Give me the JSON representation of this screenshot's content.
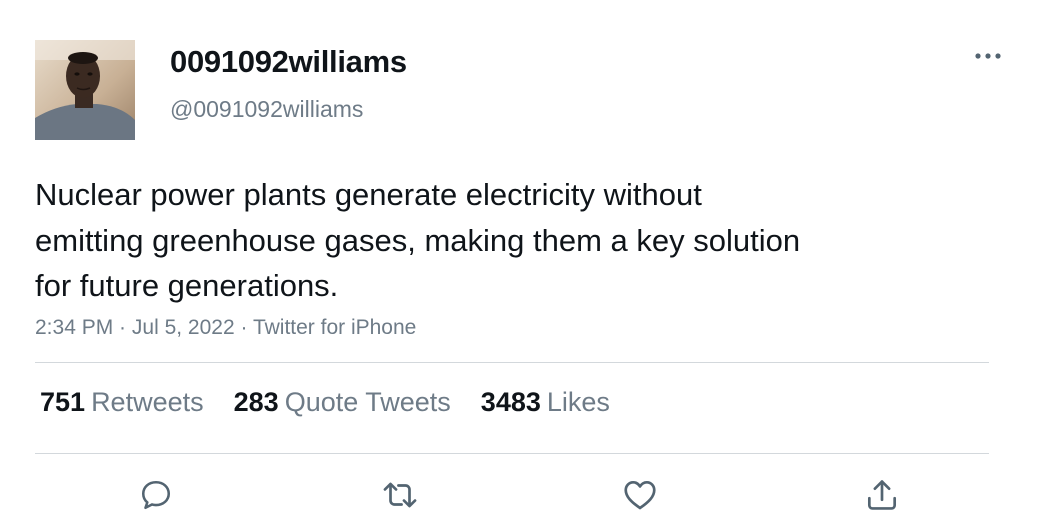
{
  "author": {
    "display_name": "0091092williams",
    "handle": "@0091092williams",
    "avatar": "profile-photo"
  },
  "more_icon": "more-horizontal-icon",
  "tweet": {
    "text_lines": [
      "Nuclear power plants generate electricity without",
      "emitting greenhouse gases, making them a key solution",
      "for future generations."
    ]
  },
  "meta": {
    "time": "2:34 PM",
    "separator": " · ",
    "date": "Jul 5, 2022",
    "source": "Twitter for iPhone"
  },
  "stats": [
    {
      "count": "751",
      "label": "Retweets"
    },
    {
      "count": "283",
      "label": "Quote Tweets"
    },
    {
      "count": "3483",
      "label": "Likes"
    }
  ],
  "actions": [
    {
      "name": "reply",
      "icon": "reply-icon"
    },
    {
      "name": "retweet",
      "icon": "retweet-icon"
    },
    {
      "name": "like",
      "icon": "like-icon"
    },
    {
      "name": "share",
      "icon": "share-icon"
    }
  ],
  "colors": {
    "text_primary": "#0f1419",
    "text_secondary": "#6e7b87",
    "divider": "#d3d8dc",
    "icon": "#536471"
  }
}
